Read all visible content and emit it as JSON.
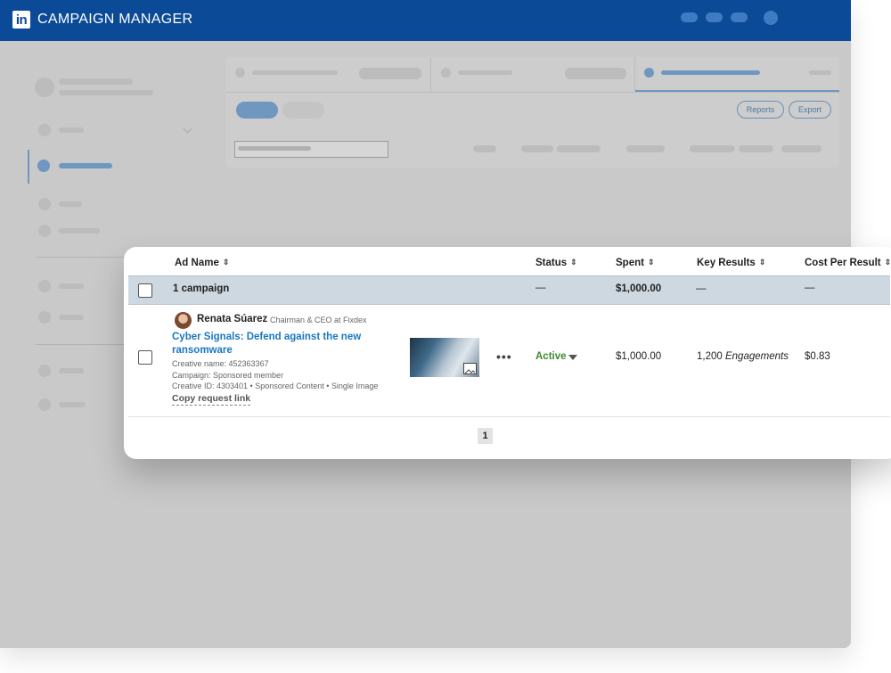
{
  "app": {
    "title": "CAMPAIGN MANAGER",
    "logo_text": "in",
    "brand_color": "#0b4a96"
  },
  "toolbar": {
    "reports_label": "Reports",
    "export_label": "Export"
  },
  "table": {
    "columns": [
      "Ad Name",
      "Status",
      "Spent",
      "Key Results",
      "Cost Per Result"
    ],
    "group_row": {
      "label": "1 campaign",
      "status": "—",
      "spent": "$1,000.00",
      "key_results": "—",
      "cost_per_result": "—"
    },
    "ad_row": {
      "author_name": "Renata Súarez",
      "author_title": "Chairman & CEO at Fixdex",
      "ad_title": "Cyber Signals: Defend against the new ransomware",
      "creative_name": "Creative name: 452363367",
      "campaign": "Campaign: Sponsored member",
      "creative_id": "Creative ID: 4303401 • Sponsored Content • Single Image",
      "copy_link": "Copy request link",
      "status": "Active",
      "status_color": "#3e8b2b",
      "spent": "$1,000.00",
      "key_results_count": "1,200",
      "key_results_unit": "Engagements",
      "cost_per_result": "$0.83"
    }
  },
  "pagination": {
    "current_page": "1"
  },
  "icons": {
    "sort": "sort-icon",
    "more": "more-icon",
    "dropdown": "chevron-down-icon",
    "image": "image-icon"
  }
}
